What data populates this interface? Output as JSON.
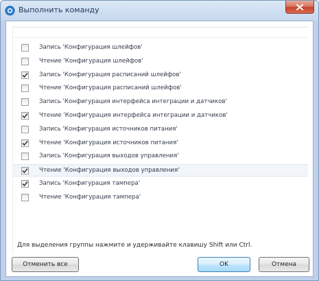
{
  "window": {
    "title": "Выполнить команду",
    "close_icon": "close-icon"
  },
  "list": {
    "items": [
      {
        "label": "Запись 'Конфигурация шлейфов'",
        "checked": false
      },
      {
        "label": "Чтение 'Конфигурация шлейфов'",
        "checked": false
      },
      {
        "label": "Запись 'Конфигурация расписаний шлейфов'",
        "checked": true
      },
      {
        "label": "Чтение 'Конфигурация расписаний шлейфов'",
        "checked": false
      },
      {
        "label": "Запись 'Конфигурация интерфейса интеграции и датчиков'",
        "checked": false
      },
      {
        "label": "Чтение 'Конфигурация интерфейса интеграции и датчиков'",
        "checked": true
      },
      {
        "label": "Запись 'Конфигурация источников питания'",
        "checked": false
      },
      {
        "label": "Чтение 'Конфигурация источников питания'",
        "checked": true
      },
      {
        "label": "Запись 'Конфигурация выходов управления'",
        "checked": false
      },
      {
        "label": "Чтение 'Конфигурация выходов управления'",
        "checked": true,
        "selected": true
      },
      {
        "label": "Запись 'Конфигурация тампера'",
        "checked": true
      },
      {
        "label": "Чтение 'Конфигурация тампера'",
        "checked": false
      }
    ]
  },
  "hint": "Для выделения группы нажмите и удерживайте клавишу Shift или Ctrl.",
  "buttons": {
    "select_all": "Отменить все",
    "ok": "OK",
    "cancel": "Отмена"
  },
  "colors": {
    "accent": "#3c7fb1",
    "close": "#c7452e",
    "check": "#3a3a3a"
  }
}
